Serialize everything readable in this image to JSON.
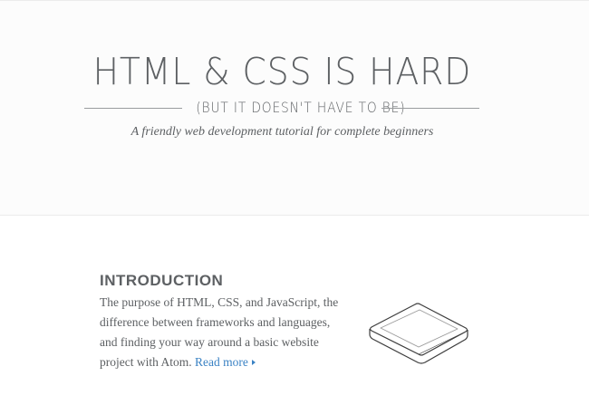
{
  "hero": {
    "title": "HTML & CSS IS HARD",
    "subtitle": "(BUT IT DOESN'T HAVE TO BE)",
    "tagline": "A friendly web development tutorial for complete beginners"
  },
  "introduction": {
    "heading": "INTRODUCTION",
    "body": "The purpose of HTML, CSS, and JavaScript, the difference between frameworks and languages, and finding your way around a basic website project with Atom.",
    "read_more_label": "Read more",
    "illustration": "tablet-icon"
  },
  "colors": {
    "text": "#5d6063",
    "link": "#3a82c4",
    "hero_background": "#fcfcfc",
    "divider": "#ececec"
  }
}
